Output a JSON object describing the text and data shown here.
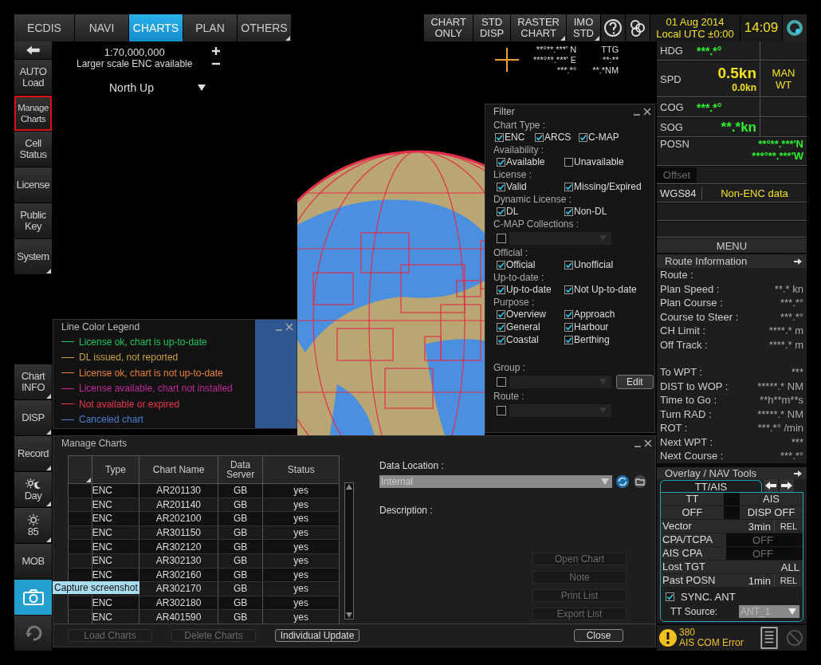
{
  "top_bar": {
    "tabs": [
      {
        "label": "ECDIS",
        "selected": false,
        "menu": false
      },
      {
        "label": "NAVI",
        "selected": false,
        "menu": false
      },
      {
        "label": "CHARTS",
        "selected": true,
        "menu": false
      },
      {
        "label": "PLAN",
        "selected": false,
        "menu": false
      },
      {
        "label": "OTHERS",
        "selected": false,
        "menu": true
      }
    ],
    "display_buttons": [
      {
        "lines": [
          "CHART",
          "ONLY"
        ],
        "menu": false
      },
      {
        "lines": [
          "STD",
          "DISP"
        ],
        "menu": false
      },
      {
        "lines": [
          "RASTER",
          "CHART"
        ],
        "menu": true
      },
      {
        "lines": [
          "IMO",
          "STD"
        ],
        "menu": true
      }
    ],
    "date": "01 Aug 2014",
    "timezone": "Local UTC ±0:00",
    "time": "14:09"
  },
  "sidebar": {
    "top_items": [
      {
        "kind": "back",
        "highlighted": false,
        "active": false,
        "menu": false
      },
      {
        "kind": "text",
        "lines": [
          "AUTO",
          "Load"
        ],
        "highlighted": false,
        "active": false,
        "menu": false
      },
      {
        "kind": "text",
        "lines": [
          "Manage",
          "Charts"
        ],
        "highlighted": true,
        "active": false,
        "menu": false
      },
      {
        "kind": "text",
        "lines": [
          "Cell",
          "Status"
        ],
        "highlighted": false,
        "active": false,
        "menu": false
      },
      {
        "kind": "text",
        "lines": [
          "License"
        ],
        "highlighted": false,
        "active": false,
        "menu": false
      },
      {
        "kind": "text",
        "lines": [
          "Public",
          "Key"
        ],
        "highlighted": false,
        "active": false,
        "menu": false
      },
      {
        "kind": "text",
        "lines": [
          "System"
        ],
        "highlighted": false,
        "active": false,
        "menu": true
      }
    ],
    "bottom_items": [
      {
        "kind": "text",
        "lines": [
          "Chart",
          "INFO"
        ],
        "highlighted": false,
        "active": false,
        "menu": true
      },
      {
        "kind": "text",
        "lines": [
          "DISP"
        ],
        "highlighted": false,
        "active": false,
        "menu": true
      },
      {
        "kind": "text",
        "lines": [
          "Record"
        ],
        "highlighted": false,
        "active": false,
        "menu": true
      },
      {
        "kind": "day",
        "lines": [
          "Day"
        ],
        "highlighted": false,
        "active": false,
        "menu": true
      },
      {
        "kind": "brightness",
        "lines": [
          "85"
        ],
        "highlighted": false,
        "active": false,
        "menu": true
      },
      {
        "kind": "text",
        "lines": [
          "MOB"
        ],
        "highlighted": false,
        "active": false,
        "menu": false
      },
      {
        "kind": "camera",
        "highlighted": false,
        "active": true,
        "menu": false
      },
      {
        "kind": "undo",
        "highlighted": false,
        "active": false,
        "menu": false
      }
    ]
  },
  "chart": {
    "scale": "1:70,000,000",
    "scale_note": "Larger scale ENC available",
    "orientation": "North Up",
    "cursor": [
      "**°**.***' N",
      "***°**.***' E",
      "***.*°"
    ],
    "ttg": [
      "TTG",
      "**:**",
      "**.*NM"
    ]
  },
  "filter": {
    "title": "Filter",
    "groups": [
      {
        "kind": "checks",
        "label": "Chart Type :",
        "options": [
          {
            "label": "ENC",
            "checked": true
          },
          {
            "label": "ARCS",
            "checked": true
          },
          {
            "label": "C-MAP",
            "checked": true
          }
        ]
      },
      {
        "kind": "checks",
        "label": "Availability :",
        "options": [
          {
            "label": "Available",
            "checked": true
          },
          {
            "label": "Unavailable",
            "checked": false
          }
        ]
      },
      {
        "kind": "checks",
        "label": "License :",
        "options": [
          {
            "label": "Valid",
            "checked": true
          },
          {
            "label": "Missing/Expired",
            "checked": true
          }
        ]
      },
      {
        "kind": "checks",
        "label": "Dynamic License :",
        "options": [
          {
            "label": "DL",
            "checked": true
          },
          {
            "label": "Non-DL",
            "checked": true
          }
        ]
      },
      {
        "kind": "select",
        "label": "C-MAP Collections :",
        "checked": false
      },
      {
        "kind": "checks",
        "label": "Official :",
        "options": [
          {
            "label": "Official",
            "checked": true
          },
          {
            "label": "Unofficial",
            "checked": true
          }
        ]
      },
      {
        "kind": "checks",
        "label": "Up-to-date :",
        "options": [
          {
            "label": "Up-to-date",
            "checked": true
          },
          {
            "label": "Not Up-to-date",
            "checked": true
          }
        ]
      },
      {
        "kind": "checks",
        "label": "Purpose :",
        "options": [
          {
            "label": "Overview",
            "checked": true
          },
          {
            "label": "Approach",
            "checked": true
          },
          {
            "label": "General",
            "checked": true
          },
          {
            "label": "Harbour",
            "checked": true
          },
          {
            "label": "Coastal",
            "checked": true
          },
          {
            "label": "Berthing",
            "checked": true
          }
        ]
      },
      {
        "kind": "select",
        "label": "Group :",
        "checked": false,
        "button": "Edit"
      },
      {
        "kind": "select",
        "label": "Route :",
        "checked": false
      }
    ]
  },
  "legend": {
    "title": "Line Color Legend",
    "items": [
      {
        "label": "License ok, chart is up-to-date",
        "color": "#22c55e"
      },
      {
        "label": "DL issued, not reported",
        "color": "#c8a23c"
      },
      {
        "label": "License ok, chart is not up-to-date",
        "color": "#e8823a"
      },
      {
        "label": "License available, chart not installed",
        "color": "#c0289c"
      },
      {
        "label": "Not available or expired",
        "color": "#e8384c"
      },
      {
        "label": "Canceled chart",
        "color": "#4a7fd0"
      }
    ]
  },
  "manage_charts": {
    "title": "Manage Charts",
    "columns": [
      "Type",
      "Chart Name",
      "Data Server",
      "Status"
    ],
    "rows": [
      {
        "type": "ENC",
        "name": "AR201130",
        "server": "GB",
        "status": "yes"
      },
      {
        "type": "ENC",
        "name": "AR201140",
        "server": "GB",
        "status": "yes"
      },
      {
        "type": "ENC",
        "name": "AR202100",
        "server": "GB",
        "status": "yes"
      },
      {
        "type": "ENC",
        "name": "AR301150",
        "server": "GB",
        "status": "yes"
      },
      {
        "type": "ENC",
        "name": "AR302120",
        "server": "GB",
        "status": "yes"
      },
      {
        "type": "ENC",
        "name": "AR302130",
        "server": "GB",
        "status": "yes"
      },
      {
        "type": "ENC",
        "name": "AR302160",
        "server": "GB",
        "status": "yes"
      },
      {
        "name": "AR302170",
        "server": "GB",
        "status": "yes"
      },
      {
        "type": "ENC",
        "name": "AR302180",
        "server": "GB",
        "status": "yes"
      },
      {
        "type": "ENC",
        "name": "AR401590",
        "server": "GB",
        "status": "yes"
      }
    ],
    "data_location_label": "Data Location :",
    "data_location": "Internal",
    "description_label": "Description :",
    "side_buttons": [
      {
        "label": "Open Chart",
        "disabled": true
      },
      {
        "label": "Note",
        "disabled": true
      },
      {
        "label": "Print List",
        "disabled": true
      },
      {
        "label": "Export List",
        "disabled": true
      }
    ],
    "bottom_buttons": [
      {
        "label": "Load Charts",
        "disabled": true
      },
      {
        "label": "Delete Charts",
        "disabled": true
      },
      {
        "label": "Individual Update",
        "disabled": false
      },
      {
        "label": "Close",
        "disabled": false
      }
    ]
  },
  "tooltip": "Capture screenshot",
  "nav": {
    "hdg": [
      "HDG",
      "***.*°"
    ],
    "spd": [
      "SPD",
      "0.5kn",
      "0.0kn"
    ],
    "mode": [
      "MAN",
      "WT"
    ],
    "cog": [
      "COG",
      "***.*°"
    ],
    "sog": [
      "SOG",
      "**.*kn"
    ],
    "posn": [
      "POSN",
      "**°**.***'N",
      "***°**.***'W"
    ],
    "offset": {
      "label": "Offset",
      "disabled": true
    },
    "datum": "WGS84",
    "data_note": "Non-ENC data",
    "menu": "MENU"
  },
  "route_info": {
    "title": "Route Information",
    "sections": [
      [
        {
          "label": "Route :"
        },
        {
          "label": "Plan Speed :",
          "value": "**.* kn"
        },
        {
          "label": "Plan Course :",
          "value": "***.*°"
        },
        {
          "label": "Course to Steer :",
          "value": "***.*°"
        },
        {
          "label": "CH Limit :",
          "value": "****.* m"
        },
        {
          "label": "Off Track :",
          "value": "****.* m"
        }
      ],
      [
        {
          "label": "To WPT :",
          "value": "***"
        },
        {
          "label": "DIST to WOP :",
          "value": "*****.* NM"
        },
        {
          "label": "Time to Go :",
          "value": "**h**m**s"
        },
        {
          "label": "Turn RAD :",
          "value": "*****.* NM"
        },
        {
          "label": "ROT :",
          "value": "***.*° /min"
        },
        {
          "label": "Next WPT :",
          "value": "***"
        },
        {
          "label": "Next Course :",
          "value": "***.*°"
        }
      ]
    ]
  },
  "overlay": {
    "title": "Overlay / NAV Tools",
    "tab": {
      "label": "TT/AIS",
      "selected": true
    },
    "heads": [
      "TT",
      "AIS"
    ],
    "states": [
      "OFF",
      "DISP OFF"
    ],
    "rows": [
      {
        "label": "Vector",
        "value": "3min",
        "extra": "REL",
        "disabled": false
      },
      {
        "label": "CPA/TCPA",
        "value": "OFF",
        "disabled": true
      },
      {
        "label": "AIS CPA",
        "value": "OFF",
        "disabled": true
      },
      {
        "label": "Lost TGT",
        "value": "ALL",
        "disabled": false
      },
      {
        "label": "Past POSN",
        "value": "1min",
        "extra": "REL",
        "disabled": false
      }
    ],
    "sync": {
      "label": "SYNC. ANT",
      "checked": true
    },
    "source_label": "TT Source:",
    "source": "ANT_1"
  },
  "alert": {
    "code": "380",
    "message": "AIS COM Error"
  }
}
